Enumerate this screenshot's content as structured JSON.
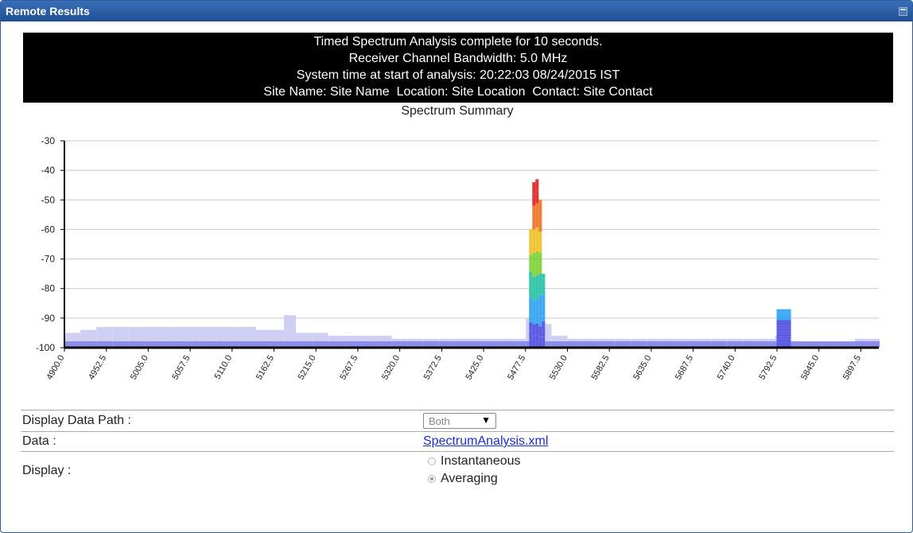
{
  "window": {
    "title": "Remote Results",
    "maximize_icon": "maximize-icon"
  },
  "banner": {
    "line1": "Timed Spectrum Analysis complete for 10 seconds.",
    "line2": "Receiver Channel Bandwidth: 5.0 MHz",
    "line3": "System time at start of analysis: 20:22:03 08/24/2015 IST",
    "line4": "Site Name: Site Name  Location: Site Location  Contact: Site Contact"
  },
  "chart_data": {
    "type": "bar",
    "title": "Spectrum Summary",
    "xlabel": "",
    "ylabel": "",
    "ylim": [
      -100,
      -30
    ],
    "y_ticks": [
      -30,
      -40,
      -50,
      -60,
      -70,
      -80,
      -90,
      -100
    ],
    "x_range": [
      4900.0,
      5920.0
    ],
    "x_ticks": [
      "4900.0",
      "4952.5",
      "5005.0",
      "5057.5",
      "5110.0",
      "5162.5",
      "5215.0",
      "5267.5",
      "5320.0",
      "5372.5",
      "5425.0",
      "5477.5",
      "5530.0",
      "5582.5",
      "5635.0",
      "5687.5",
      "5740.0",
      "5792.5",
      "5845.0",
      "5897.5"
    ],
    "grid": true,
    "legend": "none",
    "colors": {
      "peak": "#e02020",
      "low": "#6f6fe8",
      "floor": "#c7c7f2",
      "axis": "#000000"
    },
    "series": [
      {
        "values_note": "",
        "x": [
          4900,
          4920,
          4940,
          4960,
          4980,
          5000,
          5020,
          5040,
          5060,
          5080,
          5100,
          5120,
          5140,
          5160,
          5175,
          5190,
          5210,
          5230,
          5250,
          5270,
          5290,
          5310,
          5330,
          5350,
          5370,
          5390,
          5410,
          5430,
          5450,
          5470,
          5478,
          5482,
          5486,
          5490,
          5494,
          5498,
          5502,
          5510,
          5530,
          5550,
          5570,
          5590,
          5610,
          5630,
          5650,
          5670,
          5690,
          5710,
          5730,
          5750,
          5770,
          5790,
          5792,
          5810,
          5830,
          5850,
          5870,
          5890,
          5910,
          5920
        ],
        "values": [
          -95,
          -94,
          -93,
          -93,
          -93,
          -93,
          -93,
          -93,
          -93,
          -93,
          -93,
          -93,
          -94,
          -94,
          -89,
          -95,
          -95,
          -96,
          -96,
          -96,
          -96,
          -97,
          -97,
          -97,
          -97,
          -97,
          -97,
          -97,
          -97,
          -97,
          -90,
          -60,
          -44,
          -43,
          -50,
          -75,
          -92,
          -96,
          -97,
          -97,
          -97,
          -97,
          -97,
          -97,
          -97,
          -97,
          -97,
          -97,
          -97,
          -97,
          -97,
          -96,
          -87,
          -98,
          -98,
          -98,
          -98,
          -97,
          -97,
          -97
        ]
      }
    ]
  },
  "form": {
    "path_label": "Display Data Path :",
    "path_value": "Both",
    "path_caret": "▼",
    "data_label": "Data :",
    "data_link": "SpectrumAnalysis.xml",
    "display_label": "Display :",
    "option1": "Instantaneous",
    "option2": "Averaging",
    "selected_option": "Averaging"
  }
}
